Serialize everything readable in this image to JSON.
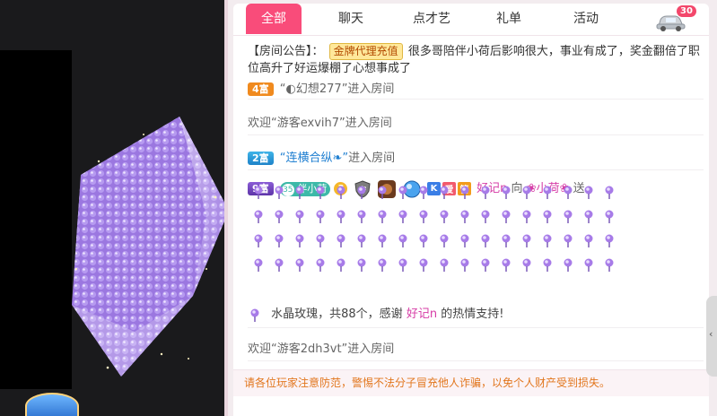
{
  "tabs": [
    {
      "label": "全部",
      "active": true
    },
    {
      "label": "聊天",
      "active": false
    },
    {
      "label": "点才艺",
      "active": false
    },
    {
      "label": "礼单",
      "active": false
    },
    {
      "label": "活动",
      "active": false
    }
  ],
  "car_badge": "30",
  "notice": {
    "title": "【房间公告】：",
    "button": "金牌代理充值",
    "text": "很多哥陪伴小荷后影响很大，事业有成了，奖金翻倍了职位高升了好运爆棚了心想事成了"
  },
  "messages": {
    "top_cut": {
      "rich": "4富",
      "text": "“◐幻想277”进入房间"
    },
    "welcome1": "欢迎“游客exvih7”进入房间",
    "welcome2": {
      "rich": "2富",
      "name": "“连横合纵❧”",
      "text": "进入房间"
    },
    "gift": {
      "rich": "9富",
      "fan_level": "35",
      "fan_label": "伴小荷",
      "level_badge": "3",
      "k_badge": "K",
      "love_badge": "爱",
      "guan_badge": "管",
      "sender": "好记n",
      "to": "向",
      "receiver": "❀小荷❀",
      "send": "送",
      "summary_prefix": "水晶玫瑰，共88个，感谢",
      "summary_name": "好记n",
      "summary_suffix": "的热情支持!"
    },
    "welcome3": "欢迎“游客2dh3vt”进入房间"
  },
  "warning": "请各位玩家注意防范，警惕不法分子冒充他人诈骗，以免个人财产受到损失。",
  "colors": {
    "accent": "#f94c7a",
    "warning": "#e2761d",
    "rose": "#a77be8"
  }
}
